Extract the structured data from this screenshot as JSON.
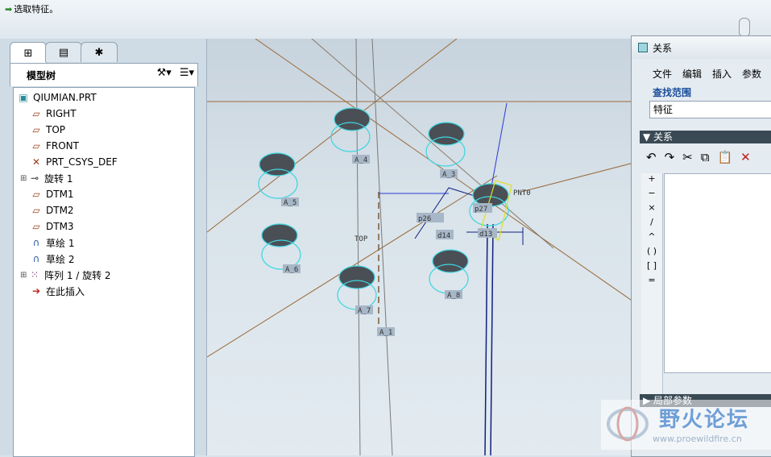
{
  "message_bar": {
    "text": "选取特征。"
  },
  "nav_tabs": [
    {
      "icon": "model-tree-icon"
    },
    {
      "icon": "folder-browser-icon"
    },
    {
      "icon": "favorites-icon"
    }
  ],
  "model_tree": {
    "title": "模型树",
    "items": [
      {
        "label": "QIUMIAN.PRT",
        "icon": "part-icon",
        "expand": false
      },
      {
        "label": "RIGHT",
        "icon": "datum-plane-icon",
        "expand": false
      },
      {
        "label": "TOP",
        "icon": "datum-plane-icon",
        "expand": false
      },
      {
        "label": "FRONT",
        "icon": "datum-plane-icon",
        "expand": false
      },
      {
        "label": "PRT_CSYS_DEF",
        "icon": "csys-icon",
        "expand": false
      },
      {
        "label": "旋转 1",
        "icon": "revolve-icon",
        "expand": true
      },
      {
        "label": "DTM1",
        "icon": "datum-plane-icon",
        "expand": false
      },
      {
        "label": "DTM2",
        "icon": "datum-plane-icon",
        "expand": false
      },
      {
        "label": "DTM3",
        "icon": "datum-plane-icon",
        "expand": false
      },
      {
        "label": "草绘 1",
        "icon": "sketch-icon",
        "expand": false
      },
      {
        "label": "草绘 2",
        "icon": "sketch-icon",
        "expand": false
      },
      {
        "label": "阵列 1 / 旋转 2",
        "icon": "pattern-icon",
        "expand": true
      },
      {
        "label": "在此插入",
        "icon": "insert-here-arrow-icon",
        "expand": false
      }
    ]
  },
  "viewport_labels": {
    "a4": "A_4",
    "a3": "A_3",
    "a5": "A_5",
    "a6": "A_6",
    "a7": "A_7",
    "a8": "A_8",
    "a1": "A_1",
    "top": "TOP",
    "pnt0": "PNT0",
    "p26": "p26",
    "p27": "p27",
    "d14": "d14",
    "d_sym": "d13"
  },
  "relations_dialog": {
    "title": "关系",
    "menu": [
      "文件",
      "编辑",
      "插入",
      "参数"
    ],
    "lookin_label": "查找范围",
    "lookin_value": "特征",
    "relations_header": "关系",
    "operators": [
      "+",
      "−",
      "×",
      "/",
      "^",
      "( )",
      "[ ]",
      "="
    ],
    "local_params_header": "局部参数"
  },
  "watermark": {
    "title": "野火论坛",
    "url": "www.proewildfire.cn"
  },
  "colors": {
    "hole_fill": "#4a4f55",
    "hole_ring": "#3fd6e0",
    "datum": "#9a6a3a",
    "axis_line": "#1a2a8a"
  }
}
